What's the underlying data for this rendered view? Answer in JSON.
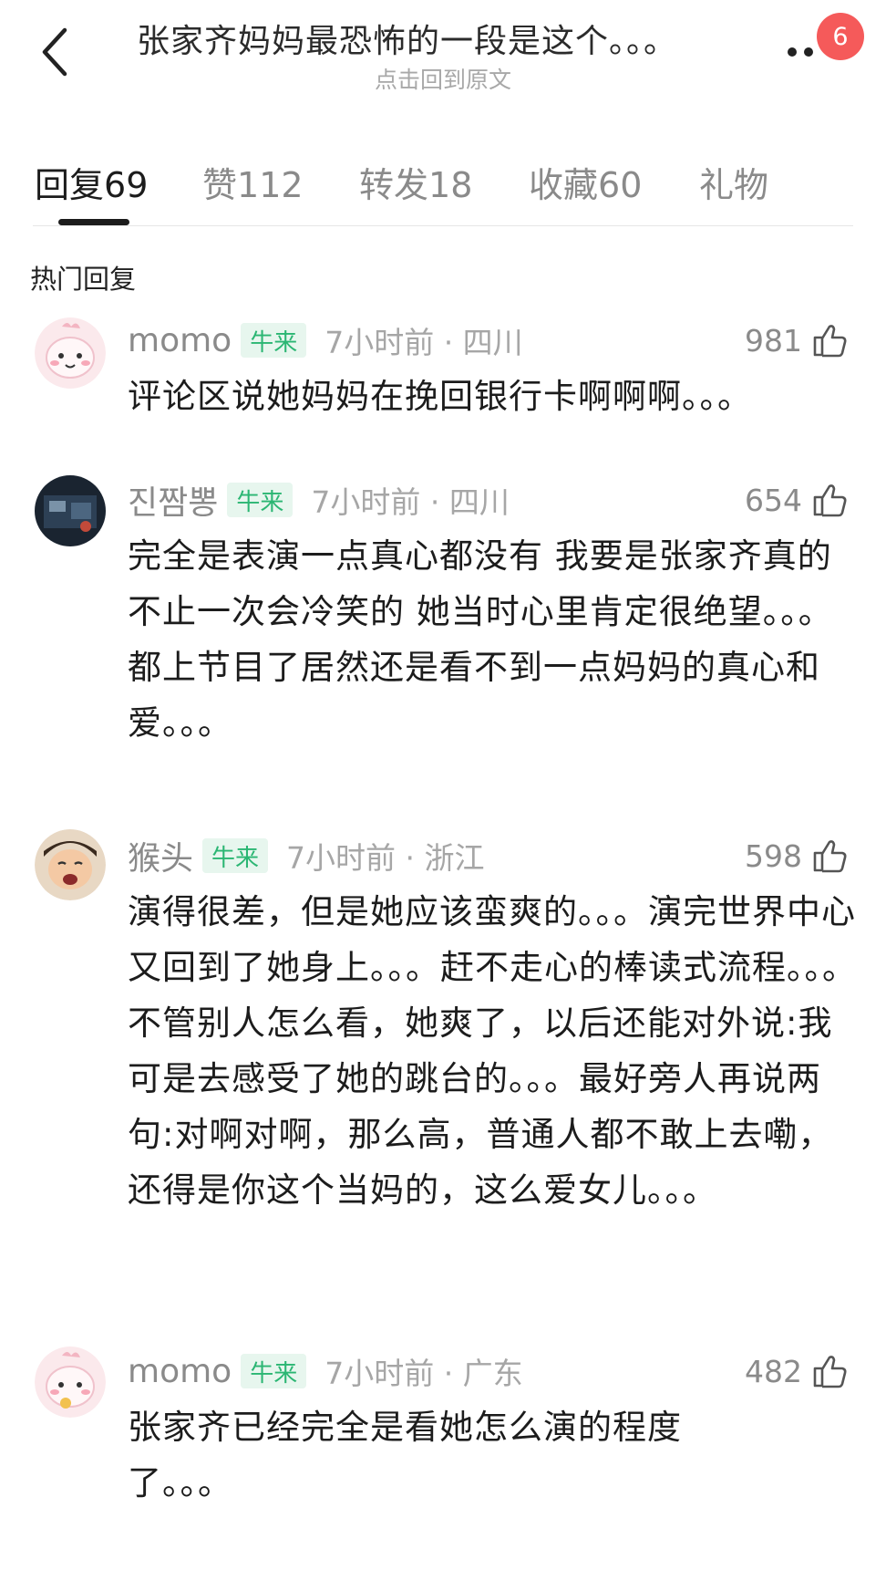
{
  "header": {
    "title": "张家齐妈妈最恐怖的一段是这个。。。",
    "subtitle": "点击回到原文",
    "badge_count": "6"
  },
  "tabs": [
    {
      "label": "回复",
      "count": "69"
    },
    {
      "label": "赞",
      "count": "112"
    },
    {
      "label": "转发",
      "count": "18"
    },
    {
      "label": "收藏",
      "count": "60"
    },
    {
      "label": "礼物",
      "count": ""
    }
  ],
  "section_title": "热门回复",
  "comments": [
    {
      "username": "momo",
      "tag": "牛来",
      "time": "7小时前 · 四川",
      "likes": "981",
      "text": "评论区说她妈妈在挽回银行卡啊啊啊。。。"
    },
    {
      "username": "진짬뽕",
      "tag": "牛来",
      "time": "7小时前 · 四川",
      "likes": "654",
      "text": "完全是表演一点真心都没有 我要是张家齐真的不止一次会冷笑的 她当时心里肯定很绝望。。。都上节目了居然还是看不到一点妈妈的真心和爱。。。"
    },
    {
      "username": "猴头",
      "tag": "牛来",
      "time": "7小时前 · 浙江",
      "likes": "598",
      "text": "演得很差，但是她应该蛮爽的。。。演完世界中心又回到了她身上。。。赶不走心的棒读式流程。。。不管别人怎么看，她爽了，以后还能对外说:我可是去感受了她的跳台的。。。最好旁人再说两句:对啊对啊，那么高，普通人都不敢上去嘞，还得是你这个当妈的，这么爱女儿。。。"
    },
    {
      "username": "momo",
      "tag": "牛来",
      "time": "7小时前 · 广东",
      "likes": "482",
      "text": "张家齐已经完全是看她怎么演的程度了。。。"
    }
  ],
  "icons": {
    "back": "chevron-left-icon",
    "more": "more-dots-icon",
    "like": "thumbs-up-icon"
  },
  "colors": {
    "badge": "#f55a5a",
    "tag_text": "#2bb673",
    "tag_bg": "#e7f6ee"
  }
}
